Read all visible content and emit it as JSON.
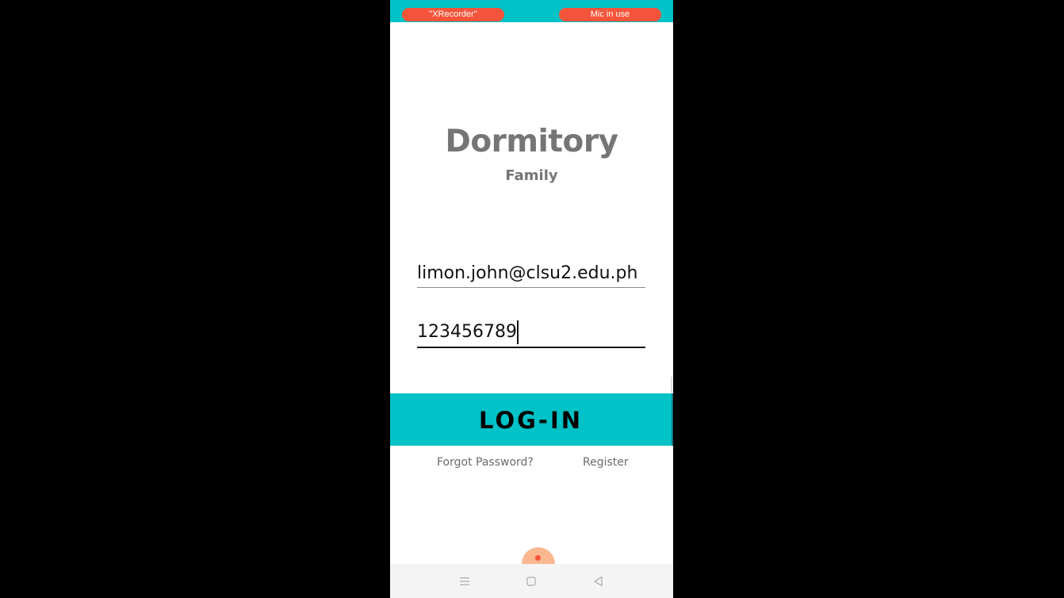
{
  "status_bar": {
    "left_pill": "\"XRecorder\"",
    "right_pill": "Mic in use",
    "accent_color": "#00c2c7",
    "pill_color": "#f4543a"
  },
  "app": {
    "title": "Dormitory",
    "subtitle": "Family"
  },
  "form": {
    "email_value": "limon.john@clsu2.edu.ph",
    "password_value": "123456789",
    "login_label": "LOG-IN",
    "forgot_password_label": "Forgot Password?",
    "register_label": "Register"
  },
  "nav_bar": {
    "icons": [
      "menu-icon",
      "home-square-icon",
      "back-triangle-icon"
    ]
  }
}
